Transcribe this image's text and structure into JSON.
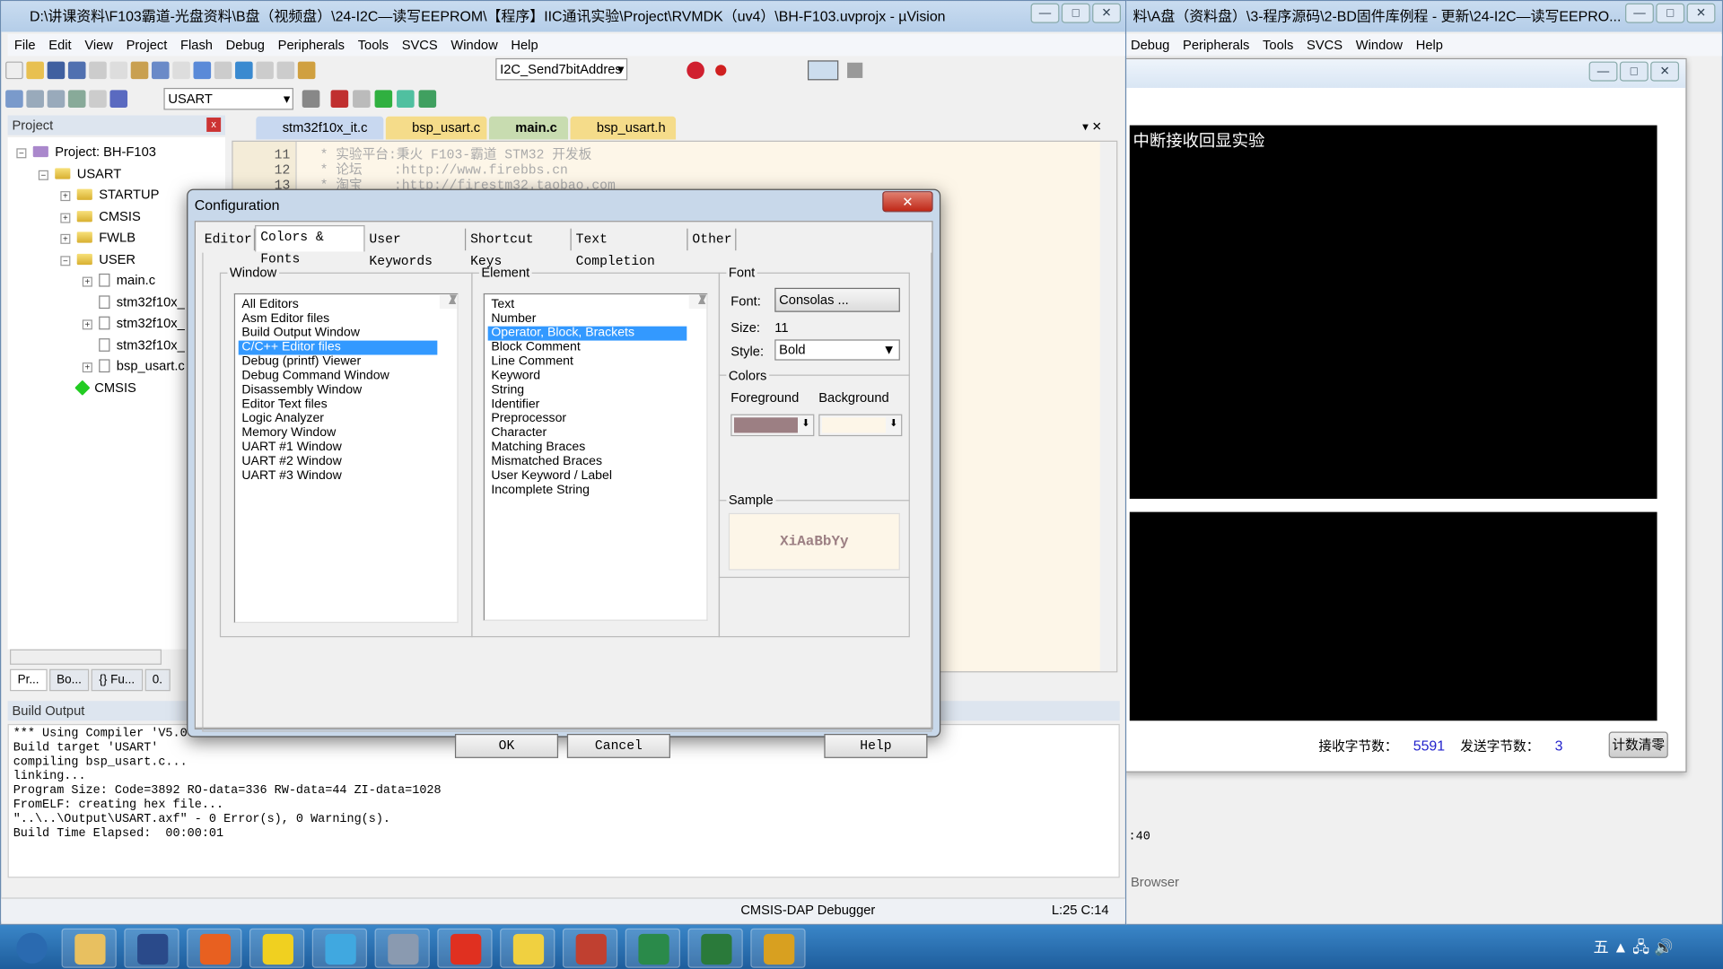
{
  "main_window": {
    "title": "D:\\讲课资料\\F103霸道-光盘资料\\B盘（视频盘）\\24-I2C—读写EEPROM\\【程序】IIC通讯实验\\Project\\RVMDK（uv4）\\BH-F103.uvprojx - µVision",
    "menu": [
      "File",
      "Edit",
      "View",
      "Project",
      "Flash",
      "Debug",
      "Peripherals",
      "Tools",
      "SVCS",
      "Window",
      "Help"
    ],
    "toolbar_function_combo": "I2C_Send7bitAddres",
    "toolbar_target_combo": "USART",
    "project_pane": {
      "title": "Project",
      "tree": [
        {
          "label": "Project: BH-F103",
          "level": 0,
          "type": "project",
          "expander": "minus"
        },
        {
          "label": "USART",
          "level": 1,
          "type": "target",
          "expander": "minus"
        },
        {
          "label": "STARTUP",
          "level": 2,
          "type": "folder",
          "expander": "plus"
        },
        {
          "label": "CMSIS",
          "level": 2,
          "type": "folder",
          "expander": "plus"
        },
        {
          "label": "FWLB",
          "level": 2,
          "type": "folder",
          "expander": "plus"
        },
        {
          "label": "USER",
          "level": 2,
          "type": "folder-open",
          "expander": "minus"
        },
        {
          "label": "main.c",
          "level": 3,
          "type": "file",
          "expander": "plus"
        },
        {
          "label": "stm32f10x_",
          "level": 3,
          "type": "file",
          "expander": ""
        },
        {
          "label": "stm32f10x_",
          "level": 3,
          "type": "file",
          "expander": "plus"
        },
        {
          "label": "stm32f10x_",
          "level": 3,
          "type": "file",
          "expander": ""
        },
        {
          "label": "bsp_usart.c",
          "level": 3,
          "type": "file",
          "expander": "plus"
        },
        {
          "label": "CMSIS",
          "level": 2,
          "type": "component",
          "expander": ""
        }
      ],
      "bottom_tabs": [
        "Pr...",
        "Bo...",
        "{} Fu...",
        "0."
      ]
    },
    "editor_tabs": [
      {
        "label": "stm32f10x_it.c",
        "color": "#c8d8f0"
      },
      {
        "label": "bsp_usart.c",
        "color": "#f5dc8a"
      },
      {
        "label": "main.c",
        "color": "#c8dcb0",
        "active": true
      },
      {
        "label": "bsp_usart.h",
        "color": "#f5dc8a"
      }
    ],
    "code_lines": [
      {
        "num": "11",
        "text": " * 实验平台:秉火 F103-霸道 STM32 开发板"
      },
      {
        "num": "12",
        "text": " * 论坛    :http://www.firebbs.cn"
      },
      {
        "num": "13",
        "text": " * 淘宝    :http://firestm32.taobao.com"
      }
    ],
    "build_output": {
      "title": "Build Output",
      "lines": [
        "*** Using Compiler 'V5.06",
        "Build target 'USART'",
        "compiling bsp_usart.c...",
        "linking...",
        "Program Size: Code=3892 RO-data=336 RW-data=44 ZI-data=1028",
        "FromELF: creating hex file...",
        "\"..\\..\\Output\\USART.axf\" - 0 Error(s), 0 Warning(s).",
        "Build Time Elapsed:  00:00:01"
      ]
    },
    "status": {
      "debugger": "CMSIS-DAP Debugger",
      "position": "L:25 C:14"
    }
  },
  "config_dialog": {
    "title": "Configuration",
    "tabs": [
      "Editor",
      "Colors & Fonts",
      "User Keywords",
      "Shortcut Keys",
      "Text Completion",
      "Other"
    ],
    "active_tab": "Colors & Fonts",
    "window_group": "Window",
    "window_items": [
      "All Editors",
      "Asm Editor files",
      "Build Output Window",
      "C/C++ Editor files",
      "Debug (printf) Viewer",
      "Debug Command Window",
      "Disassembly Window",
      "Editor Text files",
      "Logic Analyzer",
      "Memory Window",
      "UART #1 Window",
      "UART #2 Window",
      "UART #3 Window"
    ],
    "window_selected": "C/C++ Editor files",
    "element_group": "Element",
    "element_items": [
      "Text",
      "Number",
      "Operator, Block, Brackets",
      "Block Comment",
      "Line Comment",
      "Keyword",
      "String",
      "Identifier",
      "Preprocessor",
      "Character",
      "Matching Braces",
      "Mismatched Braces",
      "User Keyword / Label",
      "Incomplete String"
    ],
    "element_selected": "Operator, Block, Brackets",
    "font_group": "Font",
    "font_label": "Font:",
    "font_value": "Consolas ...",
    "size_label": "Size:",
    "size_value": "11",
    "style_label": "Style:",
    "style_value": "Bold",
    "colors_group": "Colors",
    "foreground_label": "Foreground",
    "background_label": "Background",
    "foreground_color": "#9c7f83",
    "background_color": "#fdf6e8",
    "sample_group": "Sample",
    "sample_text": "XiAaBbYy",
    "ok": "OK",
    "cancel": "Cancel",
    "help": "Help"
  },
  "second_window": {
    "title": "料\\A盘（资料盘）\\3-程序源码\\2-BD固件库例程 - 更新\\24-I2C—读写EEPRO...",
    "menu": [
      "Debug",
      "Peripherals",
      "Tools",
      "SVCS",
      "Window",
      "Help"
    ],
    "serial_text": "中断接收回显实验",
    "rx_label": "接收字节数：",
    "rx_count": "5591",
    "tx_label": "发送字节数：",
    "tx_count": "3",
    "clear_button": "计数清零",
    "fragment_time": ":40",
    "browser_tab": "Browser"
  },
  "taskbar": {
    "apps": [
      "windows-start",
      "file-explorer",
      "powershell",
      "firefox",
      "app-yellow",
      "app-cloud",
      "app-webcam",
      "app-red",
      "app-help",
      "pdf-reader",
      "app-c",
      "keil-uvision",
      "yehuo"
    ]
  }
}
